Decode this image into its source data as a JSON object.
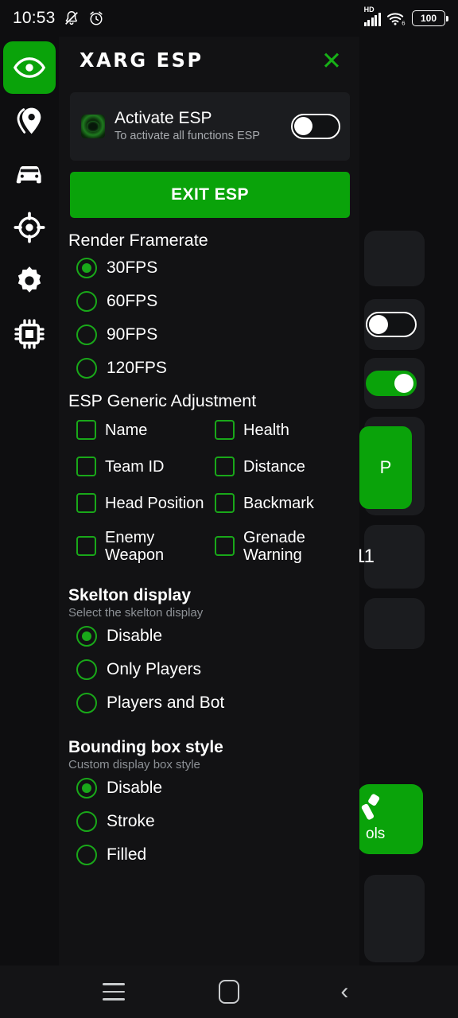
{
  "status_bar": {
    "time": "10:53",
    "icons_left": [
      "bell-mute-icon",
      "alarm-clock-icon"
    ],
    "network_label": "HD",
    "icons_right": [
      "signal-bars-icon",
      "wifi-6-icon"
    ],
    "battery_level": "100"
  },
  "sidebar": {
    "items": [
      {
        "name": "eye-icon",
        "label": "ESP",
        "active": true
      },
      {
        "name": "location-pin-icon",
        "label": "Location",
        "active": false
      },
      {
        "name": "car-icon",
        "label": "Vehicle",
        "active": false
      },
      {
        "name": "crosshair-icon",
        "label": "Aim",
        "active": false
      },
      {
        "name": "gear-icon",
        "label": "Settings",
        "active": false
      },
      {
        "name": "chip-icon",
        "label": "Memory",
        "active": false
      }
    ]
  },
  "panel": {
    "title": "XARG ESP",
    "close_label": "✕",
    "activate_card": {
      "title": "Activate ESP",
      "subtitle": "To activate all functions ESP",
      "logo_icon": "xarg-logo-icon",
      "toggle_on": false
    },
    "exit_button": "EXIT ESP",
    "sections": [
      {
        "id": "render-framerate",
        "title": "Render Framerate",
        "subtitle": "",
        "type": "radio",
        "options": [
          {
            "label": "30FPS",
            "selected": true
          },
          {
            "label": "60FPS",
            "selected": false
          },
          {
            "label": "90FPS",
            "selected": false
          },
          {
            "label": "120FPS",
            "selected": false
          }
        ]
      },
      {
        "id": "esp-generic-adjustment",
        "title": "ESP Generic Adjustment",
        "subtitle": "",
        "type": "checkbox-grid",
        "options": [
          {
            "label": "Name",
            "checked": false
          },
          {
            "label": "Health",
            "checked": false
          },
          {
            "label": "Team ID",
            "checked": false
          },
          {
            "label": "Distance",
            "checked": false
          },
          {
            "label": "Head Position",
            "checked": false
          },
          {
            "label": "Backmark",
            "checked": false
          },
          {
            "label": "Enemy Weapon",
            "checked": false
          },
          {
            "label": "Grenade Warning",
            "checked": false
          }
        ]
      },
      {
        "id": "skelton-display",
        "title": "Skelton display",
        "subtitle": "Select the skelton display",
        "type": "radio",
        "options": [
          {
            "label": "Disable",
            "selected": true
          },
          {
            "label": "Only Players",
            "selected": false
          },
          {
            "label": "Players and Bot",
            "selected": false
          }
        ]
      },
      {
        "id": "bounding-box-style",
        "title": "Bounding box style",
        "subtitle": "Custom display box style",
        "type": "radio",
        "options": [
          {
            "label": "Disable",
            "selected": true
          },
          {
            "label": "Stroke",
            "selected": false
          },
          {
            "label": "Filled",
            "selected": false
          }
        ]
      }
    ]
  },
  "background_app": {
    "toggle_off_visible": true,
    "toggle_on_visible": true,
    "green_button_text": "P",
    "counter_text": "11",
    "tools_card_label": "ols",
    "tools_card_icon": "wrench-icon"
  },
  "nav_bar": {
    "recents_label": "recents-icon",
    "home_label": "home-icon",
    "back_label": "back-icon"
  },
  "colors": {
    "accent_green": "#0aa30a",
    "outline_green": "#19a819",
    "panel_bg": "#121214",
    "card_bg": "#1b1c1f",
    "page_bg": "#0e0e10",
    "text_primary": "#ffffff",
    "text_secondary": "#8d9196"
  }
}
